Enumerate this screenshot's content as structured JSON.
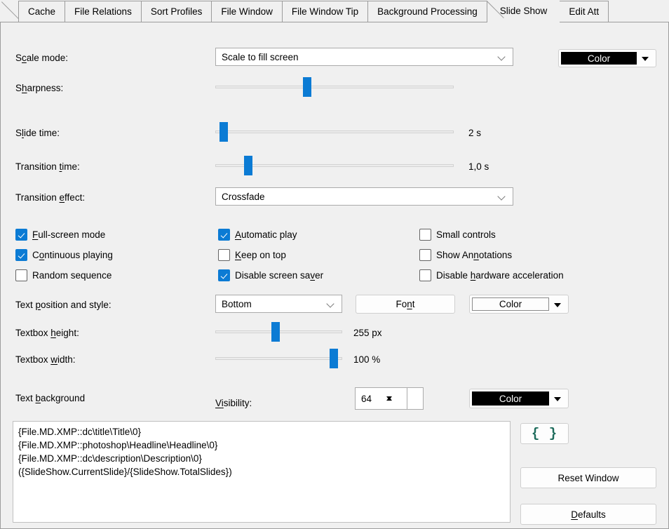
{
  "tabs": {
    "items": [
      {
        "label": "Cache",
        "active": false
      },
      {
        "label": "File Relations",
        "active": false
      },
      {
        "label": "Sort Profiles",
        "active": false
      },
      {
        "label": "File Window",
        "active": false
      },
      {
        "label": "File Window Tip",
        "active": false
      },
      {
        "label": "Background Processing",
        "active": false
      },
      {
        "label": "Slide Show",
        "active": true
      },
      {
        "label": "Edit Att",
        "active": false
      }
    ]
  },
  "form": {
    "scale_mode": {
      "label_pre": "S",
      "label_accel": "c",
      "label_post": "ale mode:",
      "value": "Scale to fill screen"
    },
    "sharpness": {
      "label_pre": "S",
      "label_accel": "h",
      "label_post": "arpness:"
    },
    "slide_time": {
      "label_pre": "S",
      "label_accel": "l",
      "label_post": "ide time:",
      "value": "2 s"
    },
    "transition_time": {
      "label_pre": "Transition ",
      "label_accel": "t",
      "label_post": "ime:",
      "value": "1,0 s"
    },
    "transition_effect": {
      "label_pre": "Transition ",
      "label_accel": "e",
      "label_post": "ffect:",
      "value": "Crossfade"
    },
    "text_position": {
      "label_pre": "Text ",
      "label_accel": "p",
      "label_post": "osition and style:",
      "value": "Bottom"
    },
    "textbox_height": {
      "label_pre": "Textbox ",
      "label_accel": "h",
      "label_post": "eight:",
      "value": "255 px"
    },
    "textbox_width": {
      "label_pre": "Textbox ",
      "label_accel": "w",
      "label_post": "idth:",
      "value": "100 %"
    },
    "text_background": {
      "label_pre": "Text ",
      "label_accel": "b",
      "label_post": "ackground"
    },
    "visibility": {
      "label_pre": "V",
      "label_accel": "i",
      "label_post": "sibility:",
      "value": "64"
    }
  },
  "checkboxes": {
    "column1": [
      {
        "pre": "",
        "accel": "F",
        "post": "ull-screen mode",
        "checked": true
      },
      {
        "pre": "C",
        "accel": "o",
        "post": "ntinuous playing",
        "checked": true
      },
      {
        "pre": "Random sequence",
        "accel": "",
        "post": "",
        "checked": false
      }
    ],
    "column2": [
      {
        "pre": "",
        "accel": "A",
        "post": "utomatic play",
        "checked": true
      },
      {
        "pre": "",
        "accel": "K",
        "post": "eep on top",
        "checked": false
      },
      {
        "pre": "Disable screen sa",
        "accel": "v",
        "post": "er",
        "checked": true
      }
    ],
    "column3": [
      {
        "pre": "Small controls",
        "accel": "",
        "post": "",
        "checked": false
      },
      {
        "pre": "Show An",
        "accel": "n",
        "post": "otations",
        "checked": false
      },
      {
        "pre": "Disable ",
        "accel": "h",
        "post": "ardware acceleration",
        "checked": false
      }
    ]
  },
  "buttons": {
    "font": {
      "pre": "Fo",
      "accel": "n",
      "post": "t"
    },
    "color_scale": "Color",
    "color_text": "Color",
    "color_background": "Color",
    "braces_icon": "{ }",
    "reset_window": "Reset Window",
    "defaults": {
      "pre": "",
      "accel": "D",
      "post": "efaults"
    }
  },
  "template_text": {
    "lines": [
      "{File.MD.XMP::dc\\title\\Title\\0}",
      "{File.MD.XMP::photoshop\\Headline\\Headline\\0}",
      "{File.MD.XMP::dc\\description\\Description\\0}",
      "({SlideShow.CurrentSlide}/{SlideShow.TotalSlides})"
    ]
  },
  "colors": {
    "accent_blue": "#0b7bd4",
    "panel_bg": "#f0f0f0",
    "braces_green": "#1d6b5b"
  }
}
